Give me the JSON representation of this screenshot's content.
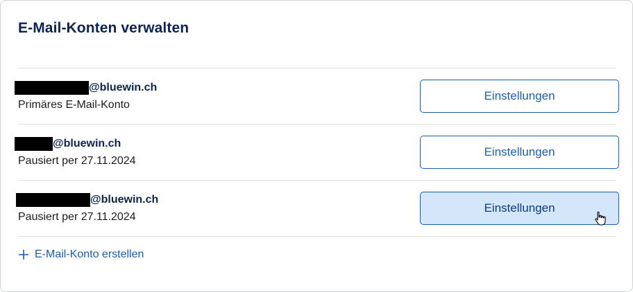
{
  "title": "E-Mail-Konten verwalten",
  "accounts": [
    {
      "domain": "@bluewin.ch",
      "status": "Primäres E-Mail-Konto",
      "button": "Einstellungen"
    },
    {
      "domain": "@bluewin.ch",
      "status": "Pausiert per 27.11.2024",
      "button": "Einstellungen"
    },
    {
      "domain": "@bluewin.ch",
      "status": "Pausiert per 27.11.2024",
      "button": "Einstellungen"
    }
  ],
  "create_link": {
    "label": "E-Mail-Konto erstellen",
    "icon": "plus-icon"
  },
  "colors": {
    "brand_navy": "#0d2350",
    "link_blue": "#1a5cb0",
    "hover_bg": "#d4e6fa"
  }
}
